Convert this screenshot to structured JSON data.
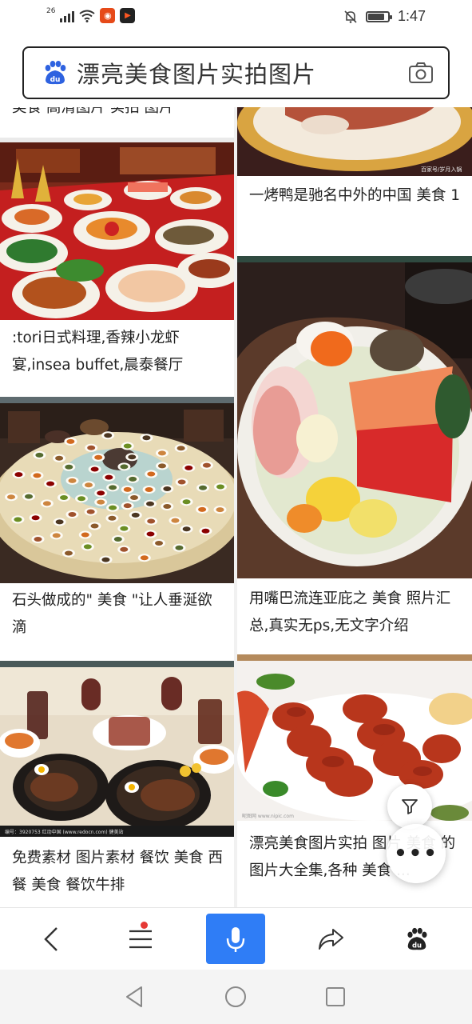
{
  "status_bar": {
    "network": "26",
    "time": "1:47",
    "battery_level": 0.85
  },
  "search": {
    "query": "漂亮美食图片实拍图片"
  },
  "feed": {
    "left": [
      {
        "caption": "美食 高清图片 实拍 图片",
        "image": "food-banquet-top"
      },
      {
        "caption": ":tori日式料理,香辣小龙虾宴,insea buffet,晨泰餐厅",
        "image": "banquet-table-dishes"
      },
      {
        "caption": "石头做成的\" 美食 \"让人垂涎欲滴",
        "image": "round-table-stone-food"
      },
      {
        "caption": "免费素材 图片素材 餐饮 美食 西餐 美食  餐饮牛排",
        "image": "steak-sizzling-plates",
        "watermark": "编号：3920753    红动中国 (www.redocn.com)    健美站"
      }
    ],
    "right": [
      {
        "caption": "一烤鸭是驰名中外的中国 美食 1",
        "image": "roast-duck-plate",
        "watermark": "百家号/岁月入锅"
      },
      {
        "caption": "用嘴巴流连亚庇之 美食 照片汇总,真实无ps,无文字介绍",
        "image": "sashimi-platter"
      },
      {
        "caption": " 漂亮美食图片实拍 图片 美食 的图片大全集,各种 美食 ...",
        "image": "grilled-sausages",
        "watermark": "昵图网 www.nipic.com"
      }
    ]
  },
  "icons": {
    "filter": "filter-icon",
    "more": "more-icon",
    "back": "back-arrow-icon",
    "menu": "menu-icon",
    "mic": "microphone-icon",
    "share": "share-icon",
    "baidu": "baidu-paw-icon",
    "camera": "camera-icon"
  },
  "fab_more_label": "•••",
  "colors": {
    "accent_blue": "#2f7df6",
    "baidu_blue": "#2e62e0",
    "notification_red": "#e53935"
  }
}
